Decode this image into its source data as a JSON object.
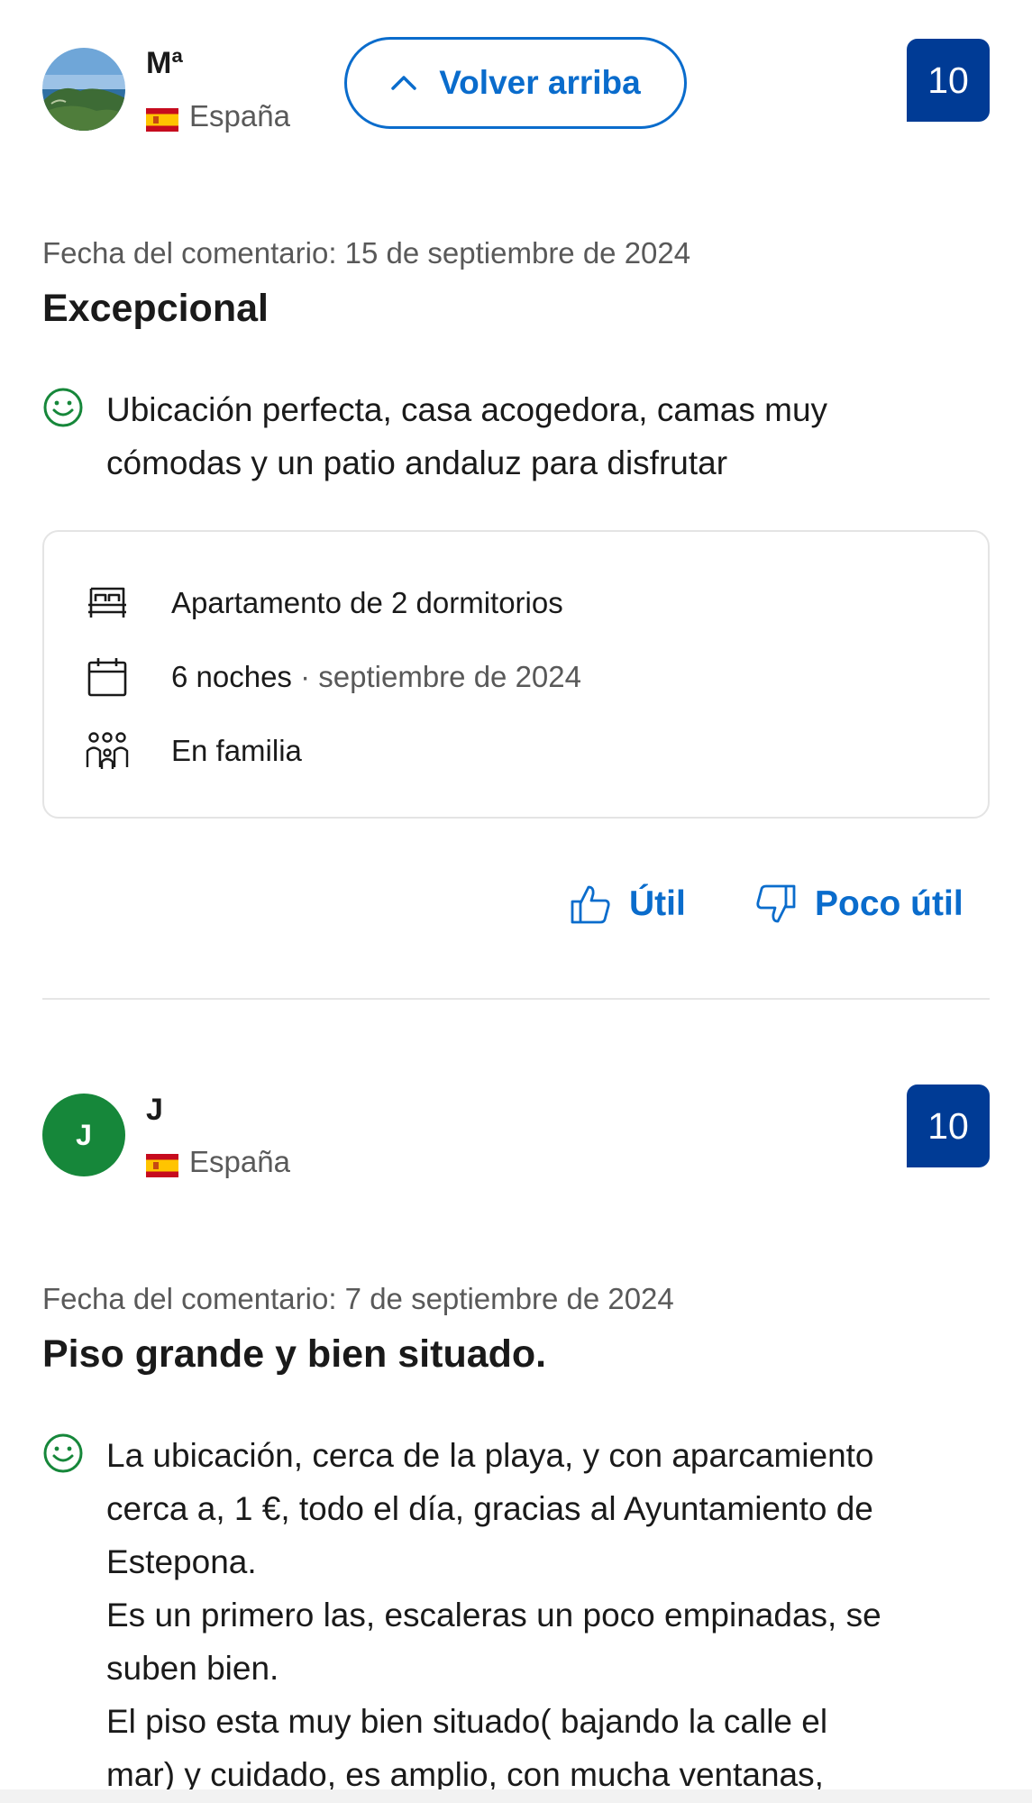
{
  "back_to_top": {
    "label": "Volver arriba"
  },
  "reviews": [
    {
      "reviewer_name": "Mª",
      "country": "España",
      "score": "10",
      "date": "Fecha del comentario: 15 de septiembre de 2024",
      "title": "Excepcional",
      "positive_lines": [
        "Ubicación perfecta, casa acogedora, camas muy",
        "cómodas y un patio andaluz para disfrutar"
      ],
      "stay": {
        "room": "Apartamento de 2 dormitorios",
        "nights": "6 noches",
        "separator": "·",
        "month": "septiembre de 2024",
        "traveler_type": "En familia"
      },
      "helpful_label": "Útil",
      "not_helpful_label": "Poco útil"
    },
    {
      "reviewer_initial": "J",
      "reviewer_name": "J",
      "country": "España",
      "score": "10",
      "date": "Fecha del comentario: 7 de septiembre de 2024",
      "title": "Piso grande y bien situado.",
      "positive_lines": [
        "La ubicación, cerca de la playa, y con aparcamiento",
        "cerca a, 1 €, todo el día, gracias al Ayuntamiento de",
        "Estepona.",
        "Es un primero las, escaleras un poco empinadas, se",
        "suben bien.",
        "El piso esta muy bien situado( bajando la calle el",
        "mar) y cuidado, es amplio, con mucha ventanas,"
      ]
    }
  ],
  "colors": {
    "accent_blue": "#0a6ccc",
    "score_bg": "#003b95",
    "avatar_green": "#16873a",
    "positive_green": "#16873a"
  },
  "icons": [
    "chevron-up-icon",
    "spain-flag-icon",
    "smile-icon",
    "bed-icon",
    "calendar-icon",
    "family-icon",
    "thumbs-up-icon",
    "thumbs-down-icon"
  ]
}
